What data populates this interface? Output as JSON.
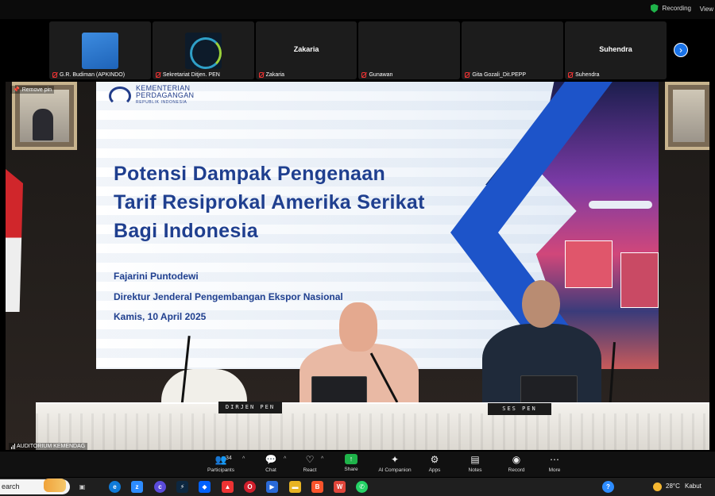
{
  "topbar": {
    "recording_label": "Recording",
    "view_label": "View"
  },
  "participants_strip": [
    {
      "name": "G.R. Budiman (APKINDO)",
      "avatar": "blue-square"
    },
    {
      "name": "Sekretariat Ditjen. PEN",
      "avatar": "pen-logo"
    },
    {
      "name": "Zakaria",
      "display": "Zakaria"
    },
    {
      "name": "Gunawan",
      "display": ""
    },
    {
      "name": "Gita Gozali_Dit.PEPP",
      "display": ""
    },
    {
      "name": "Suhendra",
      "display": "Suhendra"
    }
  ],
  "stage": {
    "pin_label": "Remove pin",
    "room_label": "AUDITORIUM KEMENDAG"
  },
  "slide": {
    "org_line1": "KEMENTERIAN",
    "org_line2": "PERDAGANGAN",
    "org_line3": "REPUBLIK INDONESIA",
    "title_line1": "Potensi Dampak Pengenaan",
    "title_line2": "Tarif Resiprokal Amerika Serikat",
    "title_line3": "Bagi Indonesia",
    "presenter": "Fajarini Puntodewi",
    "position": "Direktur Jenderal Pengembangan Ekspor Nasional",
    "date": "Kamis, 10 April 2025"
  },
  "namecards": {
    "left": "DIRJEN PEN",
    "right": "SES PEN"
  },
  "controls": {
    "participants_label": "Participants",
    "participants_count": "34",
    "chat_label": "Chat",
    "react_label": "React",
    "share_label": "Share",
    "ai_label": "AI Companion",
    "apps_label": "Apps",
    "notes_label": "Notes",
    "record_label": "Record",
    "more_label": "More"
  },
  "taskbar": {
    "search_text": "earch",
    "weather_temp": "28°C",
    "weather_desc": "Kabut"
  },
  "colors": {
    "slide_title": "#1f3f8f",
    "accent_blue": "#1d54c9",
    "recording_green": "#1fb34a",
    "mic_muted": "#e33333"
  }
}
